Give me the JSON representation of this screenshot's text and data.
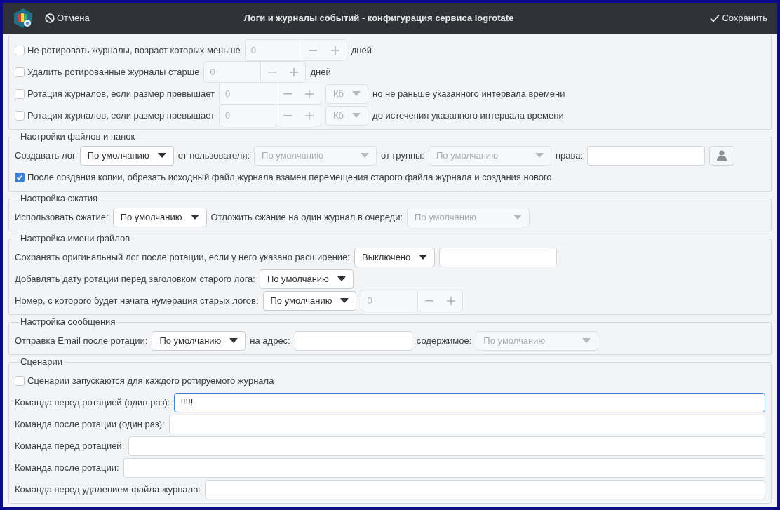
{
  "window": {
    "title": "Логи и журналы событий - конфигурация сервиса logrotate",
    "cancel": "Отмена",
    "save": "Сохранить"
  },
  "sections": [
    {
      "rows": [
        {
          "widgets": [
            {
              "kind": "checkbox",
              "label": "Не ротировать журналы, возраст которых меньше",
              "checked": false
            },
            {
              "kind": "spin",
              "value": "0",
              "disabled": true
            },
            {
              "kind": "label",
              "text": "дней"
            }
          ]
        },
        {
          "widgets": [
            {
              "kind": "checkbox",
              "label": "Удалить ротированные журналы старше",
              "checked": false
            },
            {
              "kind": "spin",
              "value": "0",
              "disabled": true
            },
            {
              "kind": "label",
              "text": "дней"
            }
          ]
        },
        {
          "widgets": [
            {
              "kind": "checkbox",
              "label": "Ротация журналов, если размер превышает",
              "checked": false
            },
            {
              "kind": "spin",
              "value": "0",
              "disabled": true
            },
            {
              "kind": "select",
              "value": "Кб",
              "disabled": true
            },
            {
              "kind": "label",
              "text": "но не раньше указанного интервала времени"
            }
          ]
        },
        {
          "widgets": [
            {
              "kind": "checkbox",
              "label": "Ротация журналов, если размер превышает",
              "checked": false
            },
            {
              "kind": "spin",
              "value": "0",
              "disabled": true
            },
            {
              "kind": "select",
              "value": "Кб",
              "disabled": true
            },
            {
              "kind": "label",
              "text": "до истечения указанного интервала времени"
            }
          ]
        }
      ]
    },
    {
      "title": "Настройки файлов и папок",
      "rows": [
        {
          "widgets": [
            {
              "kind": "label",
              "text": "Создавать лог"
            },
            {
              "kind": "select",
              "value": "По умолчанию",
              "disabled": false
            },
            {
              "kind": "label",
              "text": "от пользователя:"
            },
            {
              "kind": "select",
              "value": "По умолчанию",
              "disabled": true
            },
            {
              "kind": "label",
              "text": "от группы:"
            },
            {
              "kind": "select",
              "value": "По умолчанию",
              "disabled": true
            },
            {
              "kind": "label",
              "text": "права:"
            },
            {
              "kind": "input",
              "focused": false
            },
            {
              "kind": "icon_button"
            }
          ]
        },
        {
          "widgets": [
            {
              "kind": "checkbox",
              "label": "После создания копии, обрезать исходный файл журнала взамен перемещения старого файла журнала и создания нового",
              "checked": true
            }
          ]
        }
      ]
    },
    {
      "title": "Настройка сжатия",
      "rows": [
        {
          "widgets": [
            {
              "kind": "label",
              "text": "Использовать сжатие:"
            },
            {
              "kind": "select",
              "value": "По умолчанию",
              "disabled": false
            },
            {
              "kind": "label",
              "text": "Отложить сжание на один журнал в очереди:"
            },
            {
              "kind": "select",
              "value": "По умолчанию",
              "disabled": true
            }
          ]
        }
      ]
    },
    {
      "title": "Настройка имени файлов",
      "rows": [
        {
          "widgets": [
            {
              "kind": "label",
              "text": "Сохранять оригинальный лог после ротации, если у него указано расширение:"
            },
            {
              "kind": "select",
              "value": "Выключено",
              "disabled": false
            },
            {
              "kind": "input",
              "focused": false
            }
          ]
        },
        {
          "widgets": [
            {
              "kind": "label",
              "text": "Добавлять дату ротации перед заголовком старого лога:"
            },
            {
              "kind": "select",
              "value": "По умолчанию",
              "disabled": false
            }
          ]
        },
        {
          "widgets": [
            {
              "kind": "label",
              "text": "Номер, с которого будет начата нумерация старых логов:"
            },
            {
              "kind": "select",
              "value": "По умолчанию",
              "disabled": false
            },
            {
              "kind": "spin",
              "value": "0",
              "disabled": true
            }
          ]
        }
      ]
    },
    {
      "title": "Настройка сообщения",
      "rows": [
        {
          "widgets": [
            {
              "kind": "label",
              "text": "Отправка Email после ротации:"
            },
            {
              "kind": "select",
              "value": "По умолчанию",
              "disabled": false
            },
            {
              "kind": "label",
              "text": "на адрес:"
            },
            {
              "kind": "input",
              "focused": false
            },
            {
              "kind": "label",
              "text": "содержимое:"
            },
            {
              "kind": "select",
              "value": "По умолчанию",
              "disabled": true
            }
          ]
        }
      ]
    },
    {
      "title": "Сценарии",
      "rows": [
        {
          "widgets": [
            {
              "kind": "checkbox",
              "label": "Сценарии запускаются для каждого ротируемого журнала",
              "checked": false
            }
          ]
        },
        {
          "widgets": [
            {
              "kind": "label",
              "text": "Команда перед ротацией (один раз):"
            },
            {
              "kind": "input",
              "value": "!!!!!",
              "focused": true
            }
          ]
        },
        {
          "widgets": [
            {
              "kind": "label",
              "text": "Команда после ротации (один раз):"
            },
            {
              "kind": "input",
              "focused": false
            }
          ]
        },
        {
          "widgets": [
            {
              "kind": "label",
              "text": "Команда перед ротацией:"
            },
            {
              "kind": "input",
              "focused": false
            }
          ]
        },
        {
          "widgets": [
            {
              "kind": "label",
              "text": "Команда после ротации:"
            },
            {
              "kind": "input",
              "focused": false
            }
          ]
        },
        {
          "widgets": [
            {
              "kind": "label",
              "text": "Команда перед удалением файла журнала:"
            },
            {
              "kind": "input",
              "focused": false
            }
          ]
        }
      ]
    }
  ]
}
